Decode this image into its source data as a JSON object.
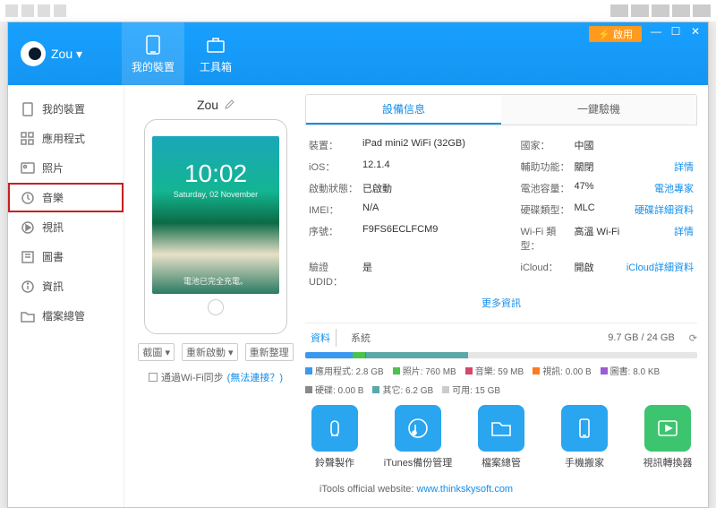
{
  "titlebar": {},
  "header": {
    "brand_name": "Zou ▾",
    "tabs": [
      {
        "label": "我的裝置"
      },
      {
        "label": "工具箱"
      }
    ],
    "badge": "⚡ 啟用",
    "win": {
      "min": "—",
      "max": "☐",
      "close": "✕"
    }
  },
  "sidebar": {
    "items": [
      {
        "label": "我的裝置"
      },
      {
        "label": "應用程式"
      },
      {
        "label": "照片"
      },
      {
        "label": "音樂"
      },
      {
        "label": "視訊"
      },
      {
        "label": "圖書"
      },
      {
        "label": "資訊"
      },
      {
        "label": "檔案總管"
      }
    ]
  },
  "device": {
    "name": "Zou",
    "clock": "10:02",
    "date": "Saturday, 02 November",
    "charged": "電池已完全充電。",
    "actions": {
      "screenshot": "截圖 ▾",
      "reboot": "重新啟動 ▾",
      "refresh": "重新整理"
    },
    "wifi_sync_label": "通過Wi-Fi同步",
    "wifi_link": "(無法連接？)"
  },
  "info_tabs": {
    "device_info": "設備信息",
    "one_click": "一鍵驗機"
  },
  "info": {
    "device_lbl": "裝置：",
    "device_val": "iPad mini2 WiFi  (32GB)",
    "country_lbl": "國家：",
    "country_val": "中國",
    "ios_lbl": "iOS：",
    "ios_val": "12.1.4",
    "acc_lbl": "輔助功能：",
    "acc_val": "關閉",
    "acc_link": "詳情",
    "act_lbl": "啟動狀態：",
    "act_val": "已啟動",
    "batt_lbl": "電池容量：",
    "batt_val": "47%",
    "batt_link": "電池專家",
    "imei_lbl": "IMEI：",
    "imei_val": "N/A",
    "disk_lbl": "硬碟類型：",
    "disk_val": "MLC",
    "disk_link": "硬碟詳細資料",
    "serial_lbl": "序號：",
    "serial_val": "F9FS6ECLFCM9",
    "wifi_lbl": "Wi-Fi 類型：",
    "wifi_val": "高溫 Wi-Fi",
    "wifi_link": "詳情",
    "udid_lbl": "驗證 UDID：",
    "udid_val": "是",
    "icloud_lbl": "iCloud：",
    "icloud_val": "開啟",
    "icloud_link": "iCloud詳細資料",
    "more": "更多資訊"
  },
  "storage": {
    "tab_data": "資料",
    "tab_system": "系統",
    "total": "9.7 GB / 24 GB",
    "bar": [
      {
        "color": "#3a99ee",
        "pct": 12
      },
      {
        "color": "#4bc24b",
        "pct": 3.2
      },
      {
        "color": "#d4476a",
        "pct": 0.3
      },
      {
        "color": "#ff7a1f",
        "pct": 0.01
      },
      {
        "color": "#9c5bd4",
        "pct": 0.01
      },
      {
        "color": "#888888",
        "pct": 0.01
      },
      {
        "color": "#5ba8a8",
        "pct": 26
      },
      {
        "color": "#e6e6e6",
        "pct": 58.5
      }
    ],
    "legend": [
      {
        "color": "#3a99ee",
        "text": "應用程式: 2.8 GB"
      },
      {
        "color": "#4bc24b",
        "text": "照片: 760 MB"
      },
      {
        "color": "#d4476a",
        "text": "音樂: 59 MB"
      },
      {
        "color": "#ff7a1f",
        "text": "視訊: 0.00 B"
      },
      {
        "color": "#9c5bd4",
        "text": "圖書: 8.0 KB"
      },
      {
        "color": "#888888",
        "text": "硬碟: 0.00 B"
      },
      {
        "color": "#5ba8a8",
        "text": "其它: 6.2 GB"
      },
      {
        "color": "#cccccc",
        "text": "可用: 15 GB"
      }
    ]
  },
  "tools": [
    {
      "color": "#2aa5f0",
      "label": "鈴聲製作",
      "icon": "bell"
    },
    {
      "color": "#2aa5f0",
      "label": "iTunes備份管理",
      "icon": "music"
    },
    {
      "color": "#2aa5f0",
      "label": "檔案總管",
      "icon": "folder"
    },
    {
      "color": "#2aa5f0",
      "label": "手機搬家",
      "icon": "phone"
    },
    {
      "color": "#3cc46e",
      "label": "視訊轉換器",
      "icon": "video"
    }
  ],
  "footer": {
    "text": "iTools official website: ",
    "link": "www.thinkskysoft.com"
  }
}
